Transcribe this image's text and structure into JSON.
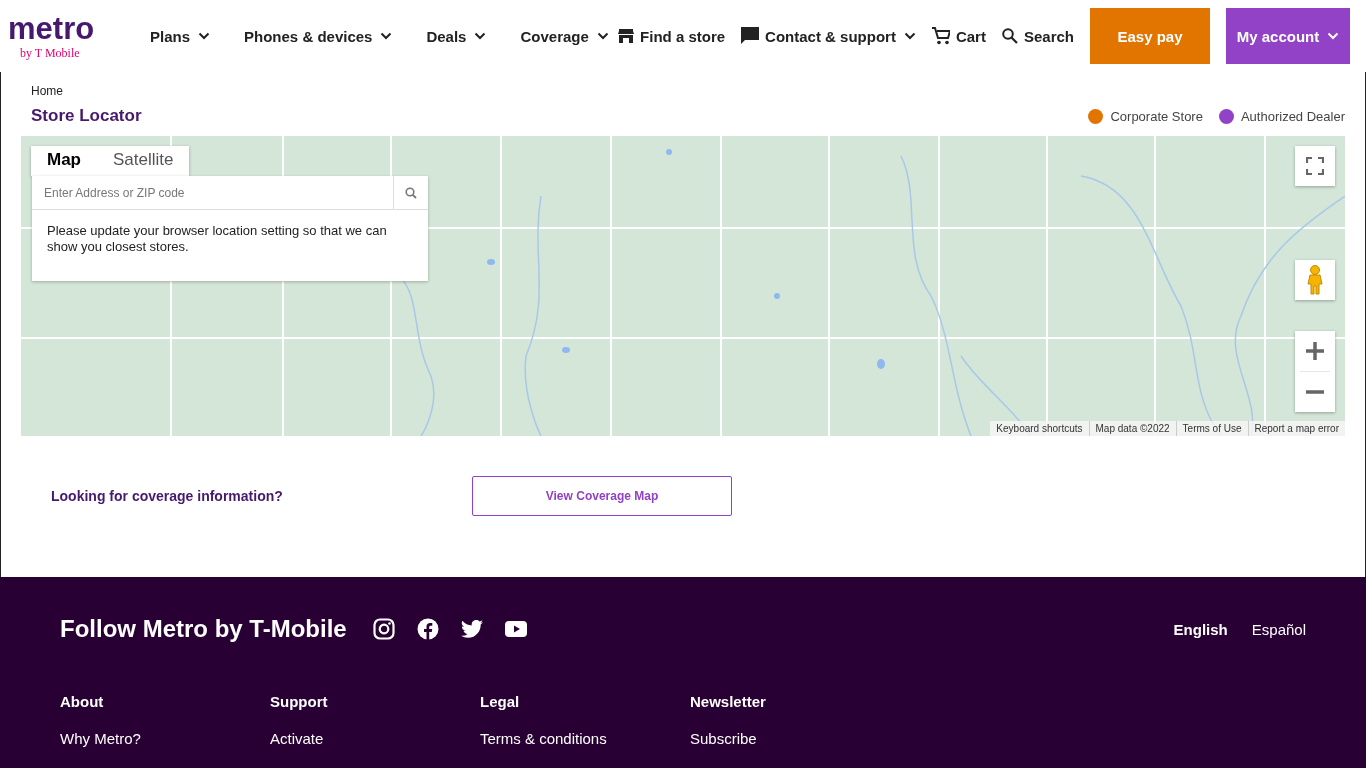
{
  "header": {
    "logo": {
      "wordmark": "metro",
      "tagline": "by T Mobile"
    },
    "nav": [
      {
        "label": "Plans",
        "dropdown": true
      },
      {
        "label": "Phones & devices",
        "dropdown": true
      },
      {
        "label": "Deals",
        "dropdown": true
      },
      {
        "label": "Coverage",
        "dropdown": true
      }
    ],
    "utility": [
      {
        "label": "Find a store",
        "kind": "store",
        "dropdown": false
      },
      {
        "label": "Contact & support",
        "kind": "chat",
        "dropdown": true
      },
      {
        "label": "Cart",
        "kind": "cart",
        "dropdown": false
      },
      {
        "label": "Search",
        "kind": "search",
        "dropdown": false
      }
    ],
    "easy_pay": {
      "label": "Easy pay"
    },
    "account": {
      "label": "My account",
      "dropdown": true
    }
  },
  "breadcrumb": [
    "Home"
  ],
  "title": "Store Locator",
  "legend": [
    {
      "label": "Corporate Store",
      "color": "#e27500"
    },
    {
      "label": "Authorized Dealer",
      "color": "#9142c6"
    }
  ],
  "map": {
    "kind": "picture",
    "map_types": [
      {
        "label": "Map",
        "selected": true
      },
      {
        "label": "Satellite",
        "selected": false
      }
    ],
    "search": {
      "placeholder": "Enter Address or ZIP code"
    },
    "message": "Please update your browser location setting so that we can show you closest stores.",
    "attribution": [
      "Keyboard shortcuts",
      "Map data ©2022",
      "Terms of Use",
      "Report a map error"
    ]
  },
  "coverage": {
    "prompt": "Looking for coverage information?",
    "button": "View Coverage Map"
  },
  "footer": {
    "follow": "Follow Metro by T-Mobile",
    "languages": [
      {
        "label": "English",
        "selected": true
      },
      {
        "label": "Español",
        "selected": false
      }
    ],
    "columns": [
      {
        "heading": "About",
        "links": [
          "Why Metro?"
        ]
      },
      {
        "heading": "Support",
        "links": [
          "Activate"
        ]
      },
      {
        "heading": "Legal",
        "links": [
          "Terms & conditions"
        ]
      },
      {
        "heading": "Newsletter",
        "links": [
          "Subscribe"
        ]
      }
    ]
  }
}
